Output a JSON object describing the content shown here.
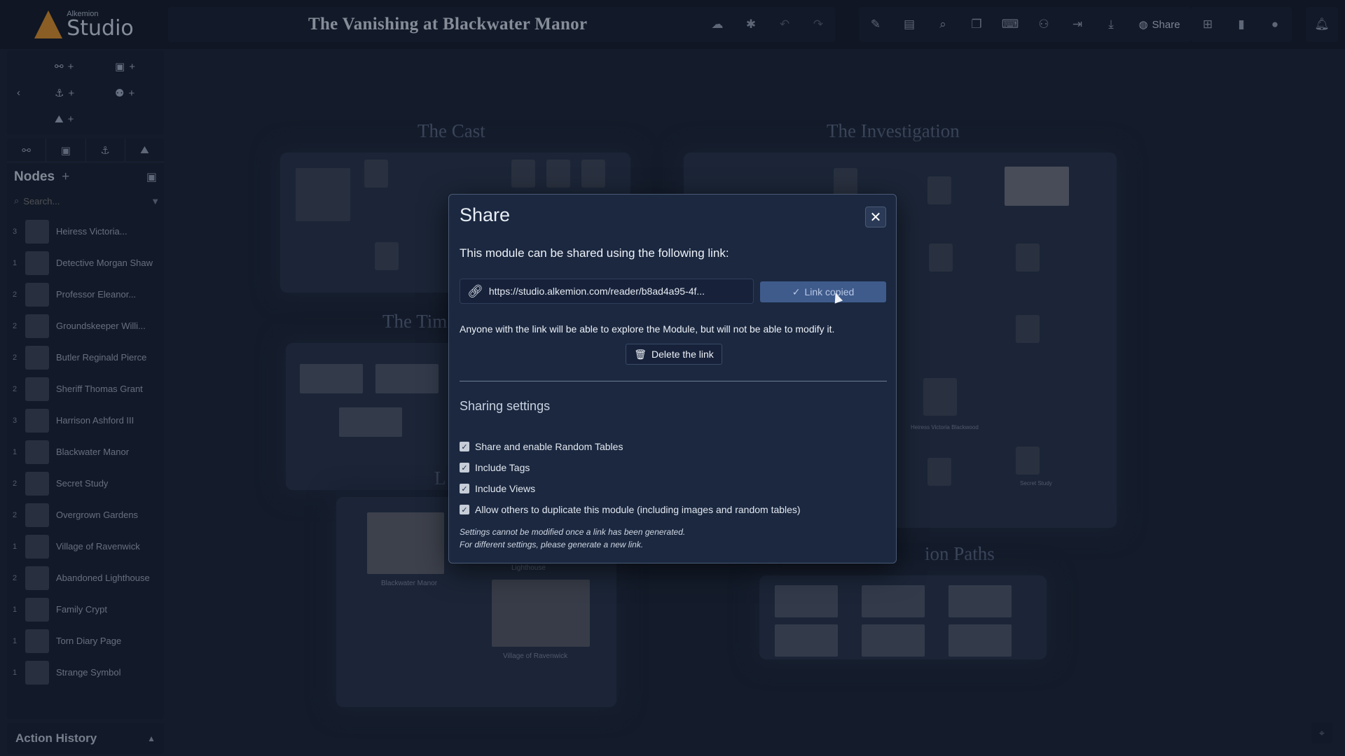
{
  "app": {
    "logo_small": "Alkemion",
    "logo_big": "Studio",
    "title": "The Vanishing at Blackwater Manor",
    "share_label": "Share"
  },
  "toolbar_icons_left": [
    "cloud-icon",
    "bug-icon",
    "undo-icon",
    "redo-icon"
  ],
  "toolbar_icons_right": [
    "note-icon",
    "table-icon",
    "search-icon",
    "duplicate-icon",
    "keyboard-icon",
    "hierarchy-icon",
    "export-icon",
    "download-icon"
  ],
  "toolbar_icons_end": [
    "grid-icon",
    "book-icon",
    "help-icon"
  ],
  "sidebar": {
    "tabs": [
      "share-nodes-icon",
      "image-icon",
      "anchor-icon",
      "map-icon"
    ],
    "nodes_title": "Nodes",
    "search_placeholder": "Search...",
    "nodes": [
      {
        "count": "3",
        "label": "Heiress Victoria..."
      },
      {
        "count": "1",
        "label": "Detective Morgan Shaw"
      },
      {
        "count": "2",
        "label": "Professor Eleanor..."
      },
      {
        "count": "2",
        "label": "Groundskeeper Willi..."
      },
      {
        "count": "2",
        "label": "Butler Reginald Pierce"
      },
      {
        "count": "2",
        "label": "Sheriff Thomas Grant"
      },
      {
        "count": "3",
        "label": "Harrison Ashford III"
      },
      {
        "count": "1",
        "label": "Blackwater Manor"
      },
      {
        "count": "2",
        "label": "Secret Study"
      },
      {
        "count": "2",
        "label": "Overgrown Gardens"
      },
      {
        "count": "1",
        "label": "Village of Ravenwick"
      },
      {
        "count": "2",
        "label": "Abandoned Lighthouse"
      },
      {
        "count": "1",
        "label": "Family Crypt"
      },
      {
        "count": "1",
        "label": "Torn Diary Page"
      },
      {
        "count": "1",
        "label": "Strange Symbol"
      }
    ],
    "action_history": "Action History"
  },
  "canvas": {
    "groups": {
      "cast": "The Cast",
      "investigation": "The Investigation",
      "timeline": "The Tim",
      "locations": "L",
      "paths": "ion Paths"
    },
    "labels": {
      "blackwater_manor": "Blackwater Manor",
      "village": "Village of Ravenwick",
      "heiress": "Heiress Victoria Blackwood",
      "secret_study": "Secret Study",
      "lighthouse": "Lighthouse"
    }
  },
  "modal": {
    "title": "Share",
    "intro": "This module can be shared using the following link:",
    "link": "https://studio.alkemion.com/reader/b8ad4a95-4f...",
    "copied_label": "Link copied",
    "notice": "Anyone with the link will be able to explore the Module, but will not be able to modify it.",
    "delete_label": "Delete the link",
    "settings_title": "Sharing settings",
    "settings": [
      {
        "label": "Share and enable Random Tables",
        "checked": true
      },
      {
        "label": "Include Tags",
        "checked": true
      },
      {
        "label": "Include Views",
        "checked": true
      },
      {
        "label": "Allow others to duplicate this module (including images and random tables)",
        "checked": true
      }
    ],
    "footnote_1": "Settings cannot be modified once a link has been generated.",
    "footnote_2": "For different settings, please generate a new link."
  }
}
